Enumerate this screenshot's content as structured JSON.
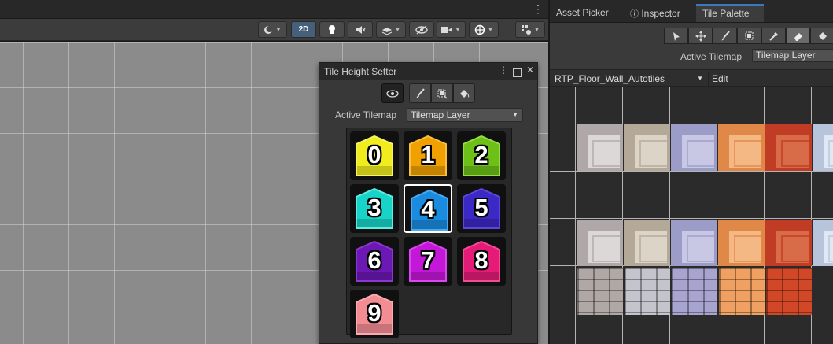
{
  "scene": {
    "toolbar": {
      "mode_2d": "2D"
    }
  },
  "ths": {
    "title": "Tile Height Setter",
    "active_tilemap_label": "Active Tilemap",
    "active_tilemap_value": "Tilemap Layer",
    "tiles": [
      {
        "label": "0",
        "color": "#f0ec1e",
        "top": "#f6f464",
        "selected": false
      },
      {
        "label": "1",
        "color": "#f0a000",
        "top": "#f6c040",
        "selected": false
      },
      {
        "label": "2",
        "color": "#6cc018",
        "top": "#98dc40",
        "selected": false
      },
      {
        "label": "3",
        "color": "#18d4c8",
        "top": "#60ece0",
        "selected": false
      },
      {
        "label": "4",
        "color": "#1a8ce0",
        "top": "#4aaaf0",
        "selected": true
      },
      {
        "label": "5",
        "color": "#3c28c4",
        "top": "#5a48dc",
        "selected": false
      },
      {
        "label": "6",
        "color": "#6c18b4",
        "top": "#8c38cc",
        "selected": false
      },
      {
        "label": "7",
        "color": "#c418d8",
        "top": "#d848ec",
        "selected": false
      },
      {
        "label": "8",
        "color": "#e41c78",
        "top": "#f04c98",
        "selected": false
      },
      {
        "label": "9",
        "color": "#f48c94",
        "top": "#f8acb0",
        "selected": false
      }
    ]
  },
  "right": {
    "tabs": [
      "Asset Picker",
      "Inspector",
      "Tile Palette"
    ],
    "active_tab": "Tile Palette",
    "active_tilemap_label": "Active Tilemap",
    "active_tilemap_value": "Tilemap Layer",
    "palette_name": "RTP_Floor_Wall_Autotiles",
    "edit_label": "Edit",
    "palette_colors": [
      {
        "base": "#dcd8d8",
        "frame": "#b0a8a8"
      },
      {
        "base": "#ddd4c8",
        "frame": "#b4a898"
      },
      {
        "base": "#c8c8e4",
        "frame": "#9c9cc8"
      },
      {
        "base": "#f4b884",
        "frame": "#e08848"
      },
      {
        "base": "#d86c48",
        "frame": "#c03c24"
      },
      {
        "base": "#e0e8f4",
        "frame": "#b8c4dc"
      }
    ],
    "brick_colors": [
      "#b0a8a4",
      "#c4c4cc",
      "#a8a4d0",
      "#f0a060",
      "#d04828"
    ]
  }
}
